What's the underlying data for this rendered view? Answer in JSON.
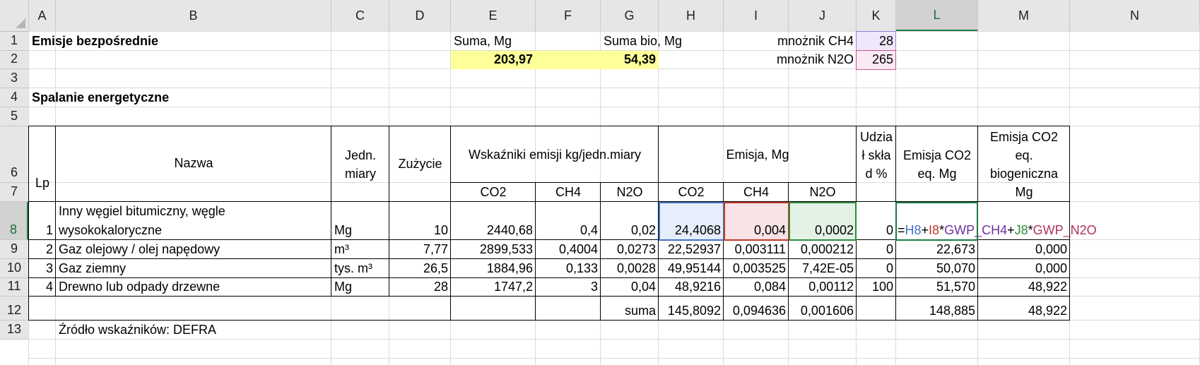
{
  "columns": [
    "A",
    "B",
    "C",
    "D",
    "E",
    "F",
    "G",
    "H",
    "I",
    "J",
    "K",
    "L",
    "M",
    "N"
  ],
  "rows": [
    "1",
    "2",
    "3",
    "4",
    "5",
    "6",
    "7",
    "8",
    "9",
    "10",
    "11",
    "12",
    "13"
  ],
  "selected_column": "L",
  "selected_row": "8",
  "cells": {
    "B1": "Emisje bezpośrednie",
    "E1": "Suma, Mg",
    "G1": "Suma bio, Mg",
    "J1": "mnożnik CH4",
    "K1": "28",
    "E2": "203,97",
    "G2": "54,39",
    "J2": "mnożnik N2O",
    "K2": "265",
    "B4": "Spalanie energetyczne",
    "A6": "Lp",
    "B6": "Nazwa",
    "C6": "Jedn. miary",
    "D6": "Zużycie",
    "E6": "Wskaźniki emisji kg/jedn.miary",
    "H6": "Emisja, Mg",
    "K6": "Udział skład %",
    "L6": "Emisja CO2 eq. Mg",
    "M6": "Emisja CO2 eq. biogeniczna Mg",
    "E7": "CO2",
    "F7": "CH4",
    "G7": "N2O",
    "H7": "CO2",
    "I7": "CH4",
    "J7": "N2O",
    "B13": "Źródło wskaźników: DEFRA"
  },
  "data_rows": [
    {
      "lp": "1",
      "name": "Inny węgiel bitumiczny, węgle wysokokaloryczne",
      "unit": "Mg",
      "usage": "10",
      "e_co2": "2440,68",
      "e_ch4": "0,4",
      "e_n2o": "0,02",
      "m_co2": "24,4068",
      "m_ch4": "0,004",
      "m_n2o": "0,0002",
      "share": "0",
      "co2eq": "",
      "bio": ""
    },
    {
      "lp": "2",
      "name": "Gaz olejowy / olej napędowy",
      "unit": "m³",
      "usage": "7,77",
      "e_co2": "2899,533",
      "e_ch4": "0,4004",
      "e_n2o": "0,0273",
      "m_co2": "22,52937",
      "m_ch4": "0,003111",
      "m_n2o": "0,000212",
      "share": "0",
      "co2eq": "22,673",
      "bio": "0,000"
    },
    {
      "lp": "3",
      "name": "Gaz ziemny",
      "unit": "tys. m³",
      "usage": "26,5",
      "e_co2": "1884,96",
      "e_ch4": "0,133",
      "e_n2o": "0,0028",
      "m_co2": "49,95144",
      "m_ch4": "0,003525",
      "m_n2o": "7,42E-05",
      "share": "0",
      "co2eq": "50,070",
      "bio": "0,000"
    },
    {
      "lp": "4",
      "name": "Drewno lub odpady drzewne",
      "unit": "Mg",
      "usage": "28",
      "e_co2": "1747,2",
      "e_ch4": "3",
      "e_n2o": "0,04",
      "m_co2": "48,9216",
      "m_ch4": "0,084",
      "m_n2o": "0,00112",
      "share": "100",
      "co2eq": "51,570",
      "bio": "48,922"
    }
  ],
  "sum_row": {
    "label": "suma",
    "m_co2": "145,8092",
    "m_ch4": "0,094636",
    "m_n2o": "0,001606",
    "co2eq": "148,885",
    "bio": "48,922"
  },
  "formula": {
    "eq": "=",
    "ref_h": "H8",
    "plus1": "+",
    "ref_i": "I8",
    "star1": "*",
    "ref_gwp_ch4": "GWP_CH4",
    "plus2": "+",
    "ref_j": "J8",
    "star2": "*",
    "ref_gwp_n2o": "GWP_N2O"
  },
  "colors": {
    "yellow_fill": "#ffff99",
    "k1_fill": "#efe8fb",
    "k2_fill": "#fbeaf3",
    "h8_fill": "#e6eefb",
    "i8_fill": "#f9e3e6",
    "j8_fill": "#e4f2e5",
    "selection": "#1f7a44"
  }
}
